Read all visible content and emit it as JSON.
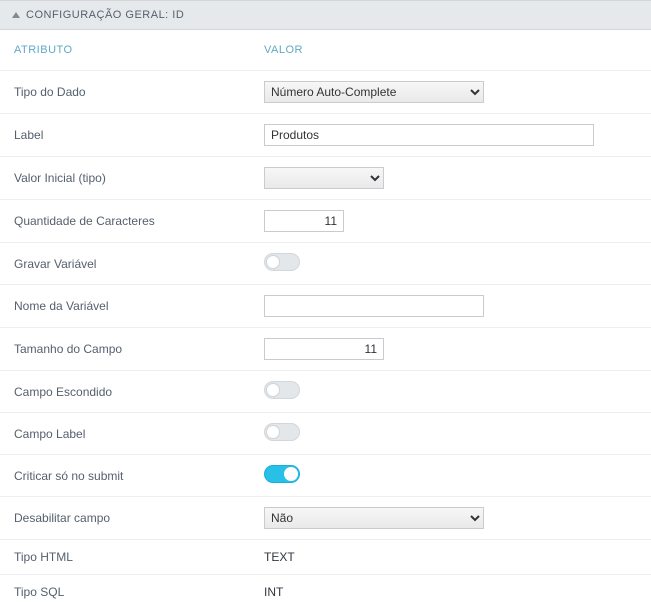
{
  "header": {
    "title": "CONFIGURAÇÃO GERAL: ID"
  },
  "columns": {
    "attribute": "ATRIBUTO",
    "value": "VALOR"
  },
  "rows": {
    "data_type": {
      "label": "Tipo do Dado",
      "value": "Número Auto-Complete"
    },
    "label": {
      "label": "Label",
      "value": "Produtos"
    },
    "initial_value": {
      "label": "Valor Inicial (tipo)",
      "value": ""
    },
    "char_qty": {
      "label": "Quantidade de Caracteres",
      "value": "11"
    },
    "save_var": {
      "label": "Gravar Variável",
      "value": "off"
    },
    "var_name": {
      "label": "Nome da Variável",
      "value": ""
    },
    "field_size": {
      "label": "Tamanho do Campo",
      "value": "11"
    },
    "hidden_field": {
      "label": "Campo Escondido",
      "value": "off"
    },
    "label_field": {
      "label": "Campo Label",
      "value": "off"
    },
    "validate_submit": {
      "label": "Criticar só no submit",
      "value": "on"
    },
    "disable_field": {
      "label": "Desabilitar campo",
      "value": "Não"
    },
    "html_type": {
      "label": "Tipo HTML",
      "value": "TEXT"
    },
    "sql_type": {
      "label": "Tipo SQL",
      "value": "INT"
    }
  }
}
